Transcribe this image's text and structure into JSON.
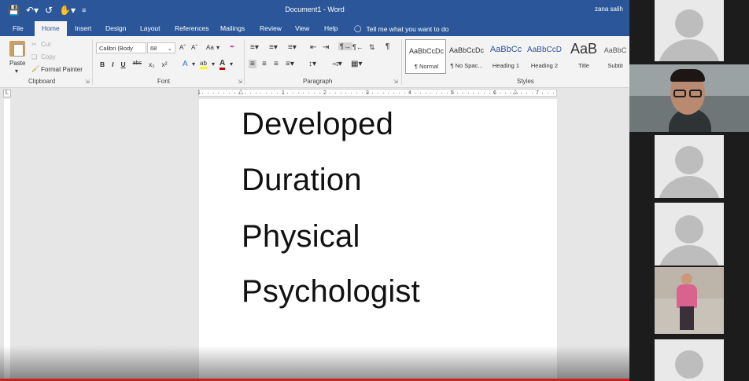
{
  "app": {
    "document_title": "Document1",
    "app_name": "Word",
    "title_separator": "-",
    "user_name": "zana salih"
  },
  "tabs": [
    "File",
    "Home",
    "Insert",
    "Design",
    "Layout",
    "References",
    "Mailings",
    "Review",
    "View",
    "Help"
  ],
  "tell_me": "Tell me what you want to do",
  "clipboard": {
    "paste": "Paste",
    "cut": "Cut",
    "copy": "Copy",
    "format_painter": "Format Painter",
    "label": "Clipboard"
  },
  "font": {
    "name": "Calibri (Body",
    "size": "68",
    "grow": "Aˆ",
    "shrink": "Aˇ",
    "case": "Aa",
    "bold": "B",
    "italic": "I",
    "underline": "U",
    "strikethrough": "abc",
    "subscript": "x₂",
    "superscript": "x²",
    "label": "Font"
  },
  "paragraph": {
    "label": "Paragraph"
  },
  "styles": {
    "label": "Styles",
    "items": [
      {
        "preview": "AaBbCcDc",
        "name": "¶ Normal"
      },
      {
        "preview": "AaBbCcDc",
        "name": "¶ No Spac..."
      },
      {
        "preview": "AaBbCc",
        "name": "Heading 1"
      },
      {
        "preview": "AaBbCcD",
        "name": "Heading 2"
      },
      {
        "preview": "AaB",
        "name": "Title"
      },
      {
        "preview": "AaBbC",
        "name": "Subtit"
      }
    ]
  },
  "ruler": {
    "numbers": [
      "1",
      "1",
      "2",
      "3",
      "4",
      "5",
      "6",
      "7"
    ],
    "corner": "L"
  },
  "document": {
    "words": [
      "Developed",
      "Duration",
      "Physical",
      "Psychologist"
    ]
  },
  "colors": {
    "ribbon_blue": "#2b579a",
    "font_color_underline": "#c00000",
    "highlight_underline": "#ffff00",
    "progress_bar": "#cc1f1f"
  }
}
